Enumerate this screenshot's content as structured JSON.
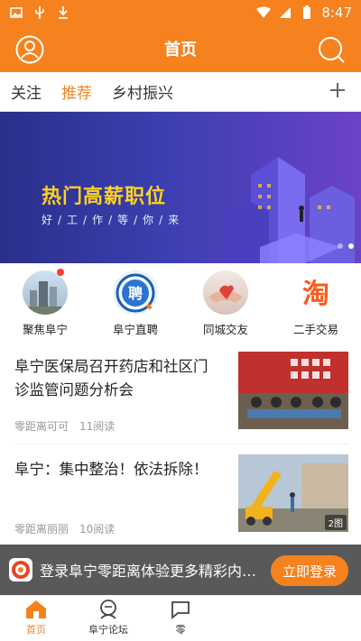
{
  "status_bar": {
    "time": "8:47",
    "icons": [
      "image-icon",
      "usb-icon",
      "download-icon",
      "wifi-icon",
      "signal-icon",
      "battery-icon"
    ]
  },
  "header": {
    "title": "首页",
    "left_icon": "user-icon",
    "right_icon": "search-icon"
  },
  "tabs": [
    {
      "label": "关注",
      "active": false
    },
    {
      "label": "推荐",
      "active": true
    },
    {
      "label": "乡村振兴",
      "active": false
    }
  ],
  "banner": {
    "title": "热门高薪职位",
    "subtitle": "好/工/作/等/你/来"
  },
  "shortcuts": [
    {
      "label": "聚焦阜宁",
      "icon": "city-icon"
    },
    {
      "label": "阜宁直聘",
      "icon": "hire-icon"
    },
    {
      "label": "同城交友",
      "icon": "handshake-icon"
    },
    {
      "label": "二手交易",
      "icon": "taobao-icon"
    }
  ],
  "articles": [
    {
      "title": "阜宁医保局召开药店和社区门诊监管问题分析会",
      "source": "零距离可可",
      "reads": "11阅读"
    },
    {
      "title": "阜宁：集中整治！依法拆除！",
      "source": "零距离丽丽",
      "reads": "10阅读",
      "image_count": "2图"
    }
  ],
  "login_bar": {
    "message": "登录阜宁零距离体验更多精彩内…",
    "button": "立即登录"
  },
  "bottom_nav": [
    {
      "label": "首页",
      "active": true
    },
    {
      "label": "阜宁论坛",
      "active": false
    },
    {
      "label": "零",
      "active": false
    }
  ],
  "colors": {
    "accent": "#f5821f",
    "banner_title": "#ffd21f"
  }
}
